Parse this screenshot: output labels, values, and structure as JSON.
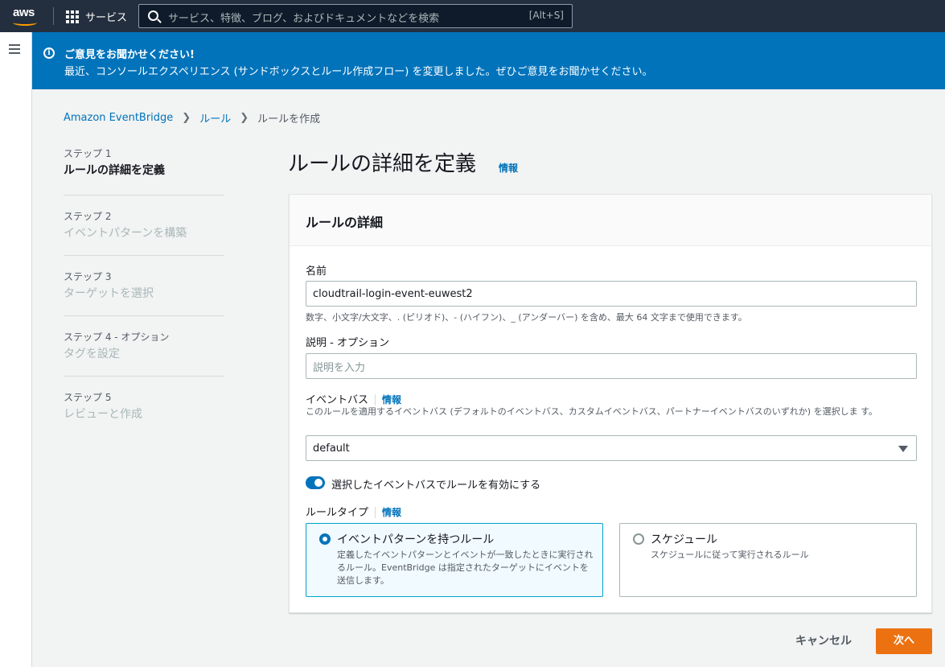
{
  "topnav": {
    "logo_text": "aws",
    "services_label": "サービス",
    "search_placeholder": "サービス、特徴、ブログ、およびドキュメントなどを検索",
    "search_shortcut": "[Alt+S]"
  },
  "banner": {
    "title": "ご意見をお聞かせください!",
    "text": "最近、コンソールエクスペリエンス (サンドボックスとルール作成フロー) を変更しました。ぜひご意見をお聞かせください。"
  },
  "breadcrumb": {
    "items": [
      "Amazon EventBridge",
      "ルール",
      "ルールを作成"
    ]
  },
  "steps": [
    {
      "number": "ステップ 1",
      "label": "ルールの詳細を定義"
    },
    {
      "number": "ステップ 2",
      "label": "イベントパターンを構築"
    },
    {
      "number": "ステップ 3",
      "label": "ターゲットを選択"
    },
    {
      "number": "ステップ 4 - オプション",
      "label": "タグを設定"
    },
    {
      "number": "ステップ 5",
      "label": "レビューと作成"
    }
  ],
  "main": {
    "title": "ルールの詳細を定義",
    "info_link": "情報",
    "panel_title": "ルールの詳細",
    "name_label": "名前",
    "name_value": "cloudtrail-login-event-euwest2",
    "name_hint": "数字、小文字/大文字、. (ピリオド)、- (ハイフン)、_ (アンダーバー) を含め、最大 64 文字まで使用できます。",
    "description_label": "説明 - オプション",
    "description_placeholder": "説明を入力",
    "eventbus_label": "イベントバス",
    "eventbus_info": "情報",
    "eventbus_hint": "このルールを適用するイベントバス (デフォルトのイベントバス、カスタムイベントバス、パートナーイベントバスのいずれか) を選択しま す。",
    "eventbus_value": "default",
    "toggle_label": "選択したイベントバスでルールを有効にする",
    "ruletype_label": "ルールタイプ",
    "ruletype_info": "情報",
    "ruletype_options": [
      {
        "title": "イベントパターンを持つルール",
        "description": "定義したイベントパターンとイベントが一致したときに実行されるルール。EventBridge は指定されたターゲットにイベントを送信します。"
      },
      {
        "title": "スケジュール",
        "description": "スケジュールに従って実行されるルール"
      }
    ]
  },
  "footer": {
    "cancel": "キャンセル",
    "next": "次へ"
  },
  "colors": {
    "nav_bg": "#232f3e",
    "banner_bg": "#0073bb",
    "link": "#0073bb",
    "primary_button": "#ec7211"
  }
}
